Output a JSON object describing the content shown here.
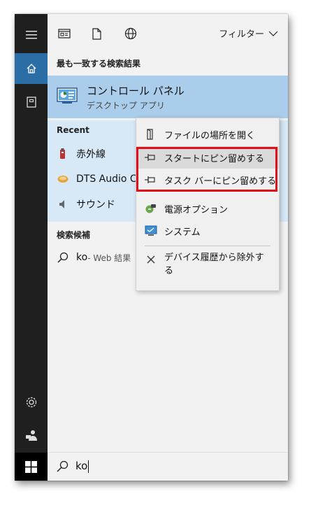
{
  "topbar": {
    "filter_label": "フィルター",
    "icons": [
      "document-icon",
      "file-icon",
      "web-icon",
      "chevron-down-icon"
    ]
  },
  "best_match": {
    "header": "最も一致する検索結果",
    "title": "コントロール パネル",
    "subtitle": "デスクトップ アプリ"
  },
  "recent": {
    "header": "Recent",
    "items": [
      {
        "label": "赤外線",
        "icon": "infrared-icon"
      },
      {
        "label": "DTS Audio Co",
        "icon": "dts-audio-icon"
      },
      {
        "label": "サウンド",
        "icon": "speaker-icon"
      }
    ]
  },
  "suggestions": {
    "header": "検索候補",
    "items": [
      {
        "query": "ko",
        "suffix": " - Web 結果"
      }
    ]
  },
  "context_menu": {
    "items": [
      {
        "label": "ファイルの場所を開く",
        "icon": "folder-open-icon"
      },
      {
        "label": "スタートにピン留めする",
        "icon": "pin-icon"
      },
      {
        "label": "タスク バーにピン留めする",
        "icon": "pin-icon"
      },
      {
        "label": "電源オプション",
        "icon": "power-options-icon"
      },
      {
        "label": "システム",
        "icon": "system-icon"
      },
      {
        "label": "デバイス履歴から除外す",
        "label2": "る",
        "icon": "close-icon"
      }
    ]
  },
  "search": {
    "value": "ko"
  },
  "colors": {
    "accent": "#2b6ea6",
    "best_match_bg": "#a9cdea",
    "highlight_box": "#e0101a"
  }
}
